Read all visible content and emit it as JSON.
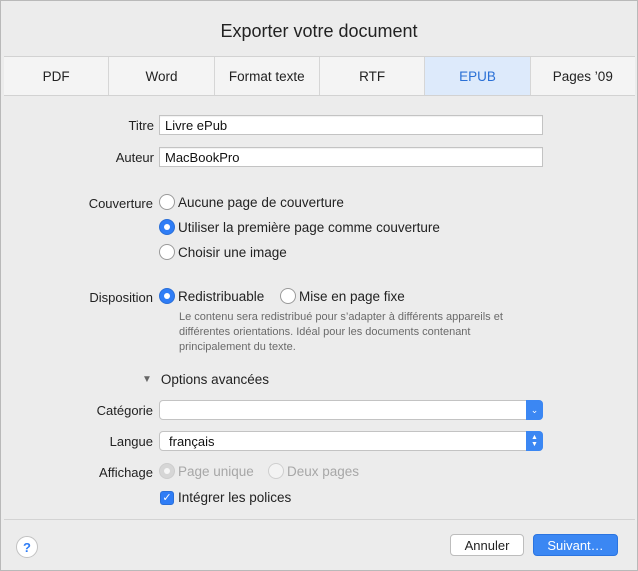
{
  "dialog": {
    "title": "Exporter votre document"
  },
  "tabs": [
    {
      "label": "PDF",
      "active": false
    },
    {
      "label": "Word",
      "active": false
    },
    {
      "label": "Format texte",
      "active": false
    },
    {
      "label": "RTF",
      "active": false
    },
    {
      "label": "EPUB",
      "active": true
    },
    {
      "label": "Pages ’09",
      "active": false
    }
  ],
  "form": {
    "title_label": "Titre",
    "title_value": "Livre ePub",
    "author_label": "Auteur",
    "author_value": "MacBookPro",
    "cover_label": "Couverture",
    "cover_options": [
      {
        "label": "Aucune page de couverture",
        "selected": false
      },
      {
        "label": "Utiliser la première page comme couverture",
        "selected": true
      },
      {
        "label": "Choisir une image",
        "selected": false
      }
    ],
    "layout_label": "Disposition",
    "layout_options": [
      {
        "label": "Redistribuable",
        "selected": true
      },
      {
        "label": "Mise en page fixe",
        "selected": false
      }
    ],
    "layout_help": "Le contenu sera redistribué pour s’adapter à différents appareils et différentes orientations. Idéal pour les documents contenant principalement du texte.",
    "advanced_label": "Options avancées",
    "category_label": "Catégorie",
    "category_value": "",
    "language_label": "Langue",
    "language_value": "français",
    "display_label": "Affichage",
    "display_options": [
      {
        "label": "Page unique",
        "selected": true
      },
      {
        "label": "Deux pages",
        "selected": false
      }
    ],
    "embed_fonts_label": "Intégrer les polices",
    "embed_fonts_checked": true
  },
  "footer": {
    "help_label": "?",
    "cancel_label": "Annuler",
    "next_label": "Suivant…"
  },
  "colors": {
    "accent": "#2f7df6",
    "active_tab_bg": "#ddeafb",
    "active_tab_text": "#2a70d6"
  },
  "icons": {
    "advanced_toggle": "disclosure-triangle-down-icon",
    "category_arrow": "chevron-down-icon",
    "language_arrow": "up-down-chevron-icon",
    "checkbox": "checkmark-icon"
  }
}
